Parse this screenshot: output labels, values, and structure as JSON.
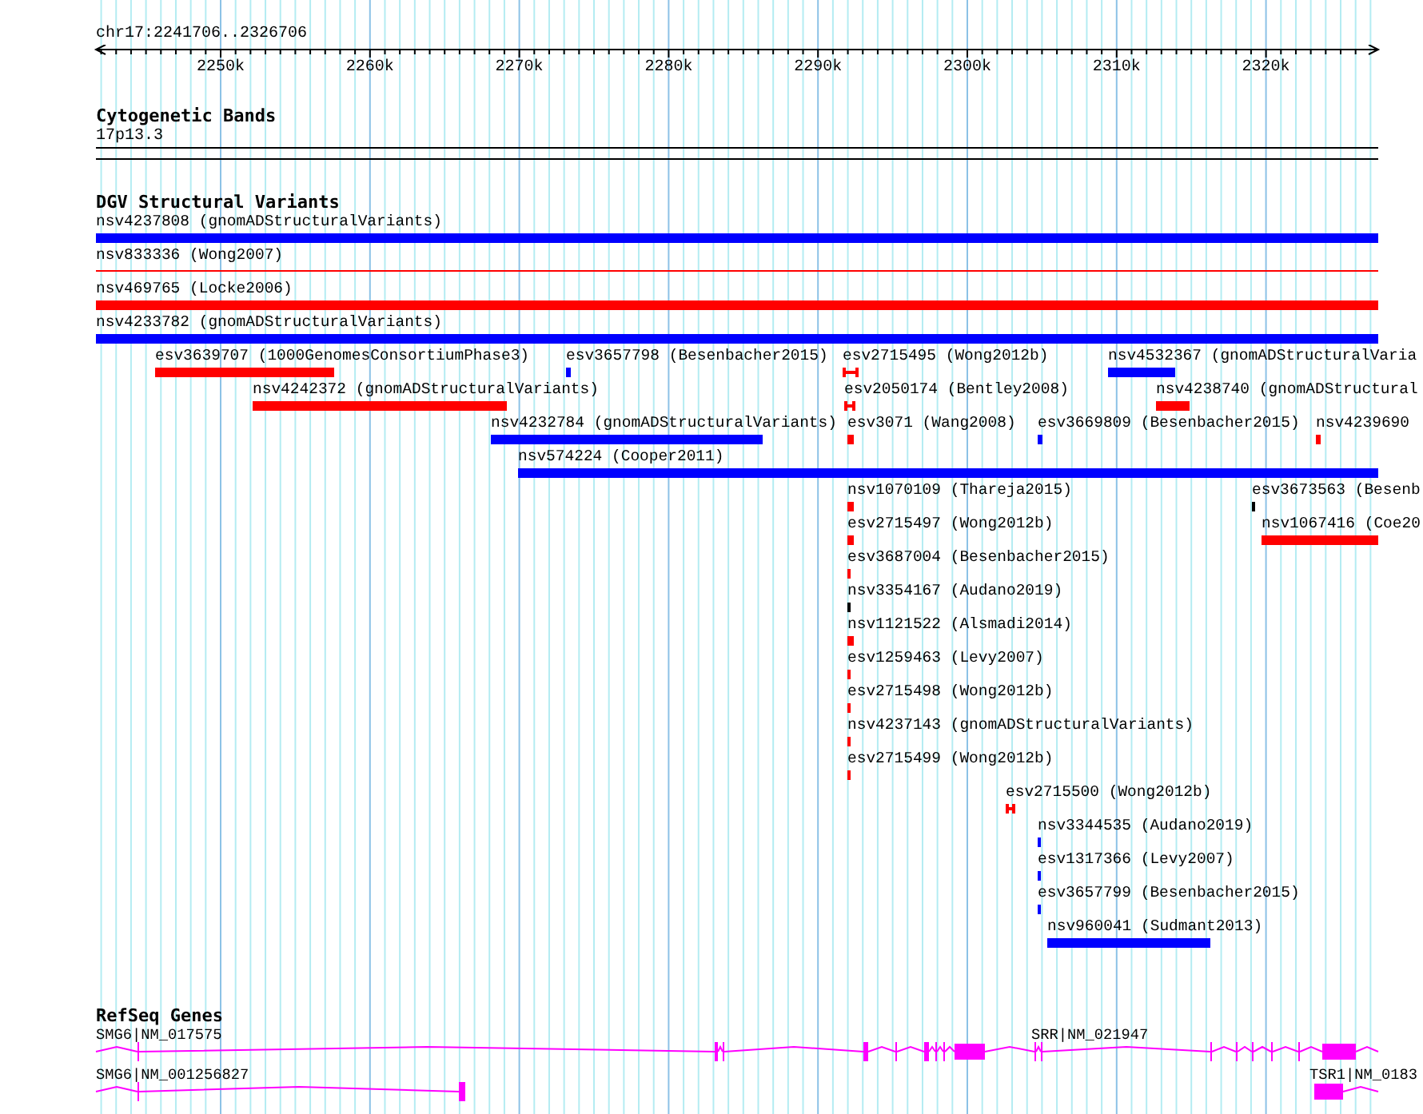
{
  "ruler": {
    "range": "chr17:2241706..2326706",
    "ticks": [
      "2250k",
      "2260k",
      "2270k",
      "2280k",
      "2290k",
      "2300k",
      "2310k",
      "2320k"
    ]
  },
  "cytoband_track": {
    "title": "Cytogenetic Bands",
    "band": "17p13.3"
  },
  "variant_track": {
    "title": "DGV Structural Variants",
    "features": [
      {
        "label": "nsv4237808 (gnomADStructuralVariants)",
        "color": "#0000ff",
        "kind": "bar"
      },
      {
        "label": "nsv833336 (Wong2007)",
        "color": "#ff0000",
        "kind": "line"
      },
      {
        "label": "nsv469765 (Locke2006)",
        "color": "#ff0000",
        "kind": "bar"
      },
      {
        "label": "nsv4233782 (gnomADStructuralVariants)",
        "color": "#0000ff",
        "kind": "bar"
      },
      {
        "label": "esv3639707 (1000GenomesConsortiumPhase3)",
        "color": "#ff0000",
        "kind": "bar"
      },
      {
        "label": "esv3657798 (Besenbacher2015)",
        "color": "#0000ff",
        "kind": "bar"
      },
      {
        "label": "esv2715495 (Wong2012b)",
        "color": "#ff0000",
        "kind": "bracket"
      },
      {
        "label": "nsv4532367 (gnomADStructuralVaria",
        "color": "#0000ff",
        "kind": "bar"
      },
      {
        "label": "nsv4242372 (gnomADStructuralVariants)",
        "color": "#ff0000",
        "kind": "bar"
      },
      {
        "label": "esv2050174 (Bentley2008)",
        "color": "#ff0000",
        "kind": "bracket"
      },
      {
        "label": "nsv4238740 (gnomADStructural",
        "color": "#ff0000",
        "kind": "bar"
      },
      {
        "label": "nsv4232784 (gnomADStructuralVariants)",
        "color": "#0000ff",
        "kind": "bar"
      },
      {
        "label": "esv3071 (Wang2008)",
        "color": "#ff0000",
        "kind": "bar"
      },
      {
        "label": "esv3669809 (Besenbacher2015)",
        "color": "#0000ff",
        "kind": "bar"
      },
      {
        "label": "nsv4239690",
        "color": "#ff0000",
        "kind": "bar"
      },
      {
        "label": "nsv574224 (Cooper2011)",
        "color": "#0000ff",
        "kind": "bar"
      },
      {
        "label": "nsv1070109 (Thareja2015)",
        "color": "#ff0000",
        "kind": "bar"
      },
      {
        "label": "esv3673563 (Besenb",
        "color": "#000000",
        "kind": "bar"
      },
      {
        "label": "esv2715497 (Wong2012b)",
        "color": "#ff0000",
        "kind": "bar"
      },
      {
        "label": "nsv1067416 (Coe20",
        "color": "#ff0000",
        "kind": "bar"
      },
      {
        "label": "esv3687004 (Besenbacher2015)",
        "color": "#ff0000",
        "kind": "bar"
      },
      {
        "label": "nsv3354167 (Audano2019)",
        "color": "#000000",
        "kind": "bar"
      },
      {
        "label": "nsv1121522 (Alsmadi2014)",
        "color": "#ff0000",
        "kind": "bar"
      },
      {
        "label": "esv1259463 (Levy2007)",
        "color": "#ff0000",
        "kind": "bar"
      },
      {
        "label": "esv2715498 (Wong2012b)",
        "color": "#ff0000",
        "kind": "bar"
      },
      {
        "label": "nsv4237143 (gnomADStructuralVariants)",
        "color": "#ff0000",
        "kind": "bar"
      },
      {
        "label": "esv2715499 (Wong2012b)",
        "color": "#ff0000",
        "kind": "bar"
      },
      {
        "label": "esv2715500 (Wong2012b)",
        "color": "#ff0000",
        "kind": "bracket"
      },
      {
        "label": "nsv3344535 (Audano2019)",
        "color": "#0000ff",
        "kind": "bar"
      },
      {
        "label": "esv1317366 (Levy2007)",
        "color": "#0000ff",
        "kind": "bar"
      },
      {
        "label": "esv3657799 (Besenbacher2015)",
        "color": "#0000ff",
        "kind": "bar"
      },
      {
        "label": "nsv960041 (Sudmant2013)",
        "color": "#0000ff",
        "kind": "bar"
      }
    ]
  },
  "gene_track": {
    "title": "RefSeq Genes",
    "genes": [
      {
        "label": "SMG6|NM_017575"
      },
      {
        "label": "SRR|NM_021947"
      },
      {
        "label": "SMG6|NM_001256827"
      },
      {
        "label": "TSR1|NM_0183"
      }
    ]
  }
}
